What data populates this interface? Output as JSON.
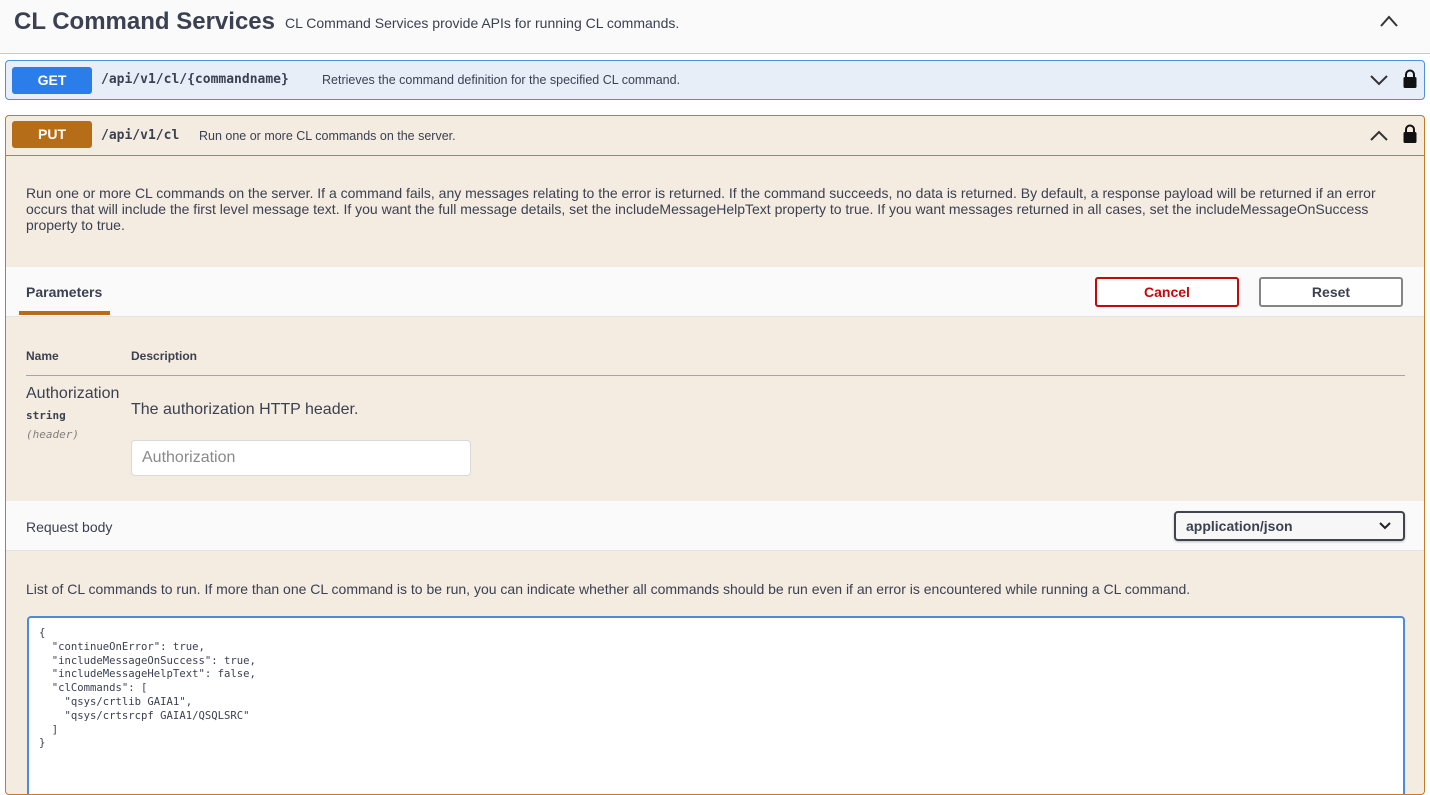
{
  "section": {
    "title": "CL Command Services",
    "description": "CL Command Services provide APIs for running CL commands."
  },
  "get_op": {
    "method": "GET",
    "path": "/api/v1/cl/{commandname}",
    "summary": "Retrieves the command definition for the specified CL command."
  },
  "put_op": {
    "method": "PUT",
    "path": "/api/v1/cl",
    "summary": "Run one or more CL commands on the server.",
    "description": "Run one or more CL commands on the server. If a command fails, any messages relating to the error is returned. If the command succeeds, no data is returned. By default, a response payload will be returned if an error occurs that will include the first level message text. If you want the full message details, set the includeMessageHelpText property to true. If you want messages returned in all cases, set the includeMessageOnSuccess property to true.",
    "parameters": {
      "tab_label": "Parameters",
      "cancel_label": "Cancel",
      "reset_label": "Reset",
      "col_name": "Name",
      "col_description": "Description",
      "items": [
        {
          "name": "Authorization",
          "type": "string",
          "in": "(header)",
          "description": "The authorization HTTP header.",
          "placeholder": "Authorization"
        }
      ]
    },
    "request_body": {
      "label": "Request body",
      "content_type": "application/json",
      "description": "List of CL commands to run. If more than one CL command is to be run, you can indicate whether all commands should be run even if an error is encountered while running a CL command.",
      "code_lines": [
        "{",
        "  \"continueOnError\": true,",
        "  \"includeMessageOnSuccess\": true,",
        "  \"includeMessageHelpText\": false,",
        "  \"clCommands\": [",
        "    \"qsys/crtlib GAIA1\",",
        "    \"qsys/crtsrcpf GAIA1/QSQLSRC\"",
        "  ]",
        "}"
      ]
    }
  },
  "colors": {
    "get": "#2b7de9",
    "put": "#b66d18",
    "cancel": "#c40808"
  },
  "icons": [
    "chevron-up-icon",
    "chevron-down-icon",
    "lock-icon"
  ]
}
